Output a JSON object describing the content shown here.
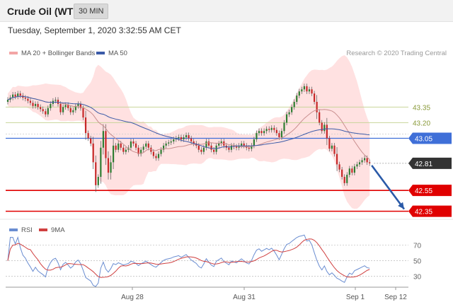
{
  "header": {
    "title": "Crude Oil (WTI)",
    "timeframe": "30 MIN"
  },
  "datetime": "Tuesday, September 1, 2020 3:32:55 AM CET",
  "colors": {
    "bollinger": "#ffc8c8",
    "ma20": "#c98f8f",
    "ma50": "#3b5ba8",
    "support": "#e00000",
    "resistance": "#c8d49a",
    "pivot": "#3f6fd8",
    "price_tag": "#333333",
    "rsi": "#6a8dd1",
    "rsi_ma": "#d04040",
    "arrow": "#2a5aa8"
  },
  "chart_data": [
    {
      "type": "candlestick",
      "legend": [
        "MA 20 + Bollinger Bands",
        "MA 50"
      ],
      "credit": "Research © 2020 Trading Central",
      "levels": [
        {
          "value": 43.35,
          "label": "43.35",
          "kind": "resistance"
        },
        {
          "value": 43.2,
          "label": "43.20",
          "kind": "resistance"
        },
        {
          "value": 43.05,
          "label": "43.05",
          "kind": "pivot"
        },
        {
          "value": 42.81,
          "label": "42.81",
          "kind": "last"
        },
        {
          "value": 42.55,
          "label": "42.55",
          "kind": "support"
        },
        {
          "value": 42.35,
          "label": "42.35",
          "kind": "support"
        }
      ],
      "ylim": [
        42.3,
        43.78
      ],
      "x_ticks": [
        "Aug 28",
        "Aug 31",
        "Sep 1",
        "Sep 12"
      ],
      "close": [
        43.42,
        43.44,
        43.47,
        43.45,
        43.48,
        43.46,
        43.44,
        43.43,
        43.41,
        43.39,
        43.36,
        43.38,
        43.35,
        43.33,
        43.31,
        43.28,
        43.34,
        43.38,
        43.41,
        43.42,
        43.38,
        43.3,
        43.35,
        43.37,
        43.34,
        43.3,
        43.32,
        43.36,
        43.38,
        43.34,
        43.25,
        43.1,
        43.05,
        43.0,
        42.82,
        42.6,
        42.68,
        42.96,
        43.12,
        42.86,
        42.72,
        42.82,
        42.98,
        42.94,
        43.0,
        42.96,
        42.92,
        42.94,
        42.96,
        43.02,
        43.0,
        42.96,
        42.9,
        42.94,
        42.97,
        43.0,
        42.96,
        42.92,
        42.88,
        42.86,
        42.9,
        42.94,
        42.98,
        43.0,
        43.01,
        43.02,
        43.04,
        43.05,
        43.06,
        43.04,
        43.06,
        43.08,
        43.05,
        43.02,
        43.0,
        42.98,
        42.94,
        42.92,
        42.96,
        43.02,
        42.98,
        42.94,
        42.92,
        42.98,
        43.0,
        43.02,
        42.98,
        42.96,
        42.94,
        42.98,
        42.97,
        42.96,
        42.98,
        43.0,
        42.98,
        42.96,
        42.95,
        42.98,
        43.04,
        43.1,
        43.12,
        43.1,
        43.12,
        43.14,
        43.13,
        43.15,
        43.13,
        43.1,
        43.06,
        43.12,
        43.2,
        43.28,
        43.3,
        43.35,
        43.4,
        43.46,
        43.5,
        43.52,
        43.55,
        43.5,
        43.52,
        43.48,
        43.4,
        43.3,
        43.2,
        43.12,
        43.18,
        43.05,
        42.95,
        42.98,
        42.9,
        42.8,
        42.75,
        42.68,
        42.62,
        42.7,
        42.76,
        42.72,
        42.78,
        42.8,
        42.82,
        42.84,
        42.86,
        42.82,
        42.81
      ]
    },
    {
      "type": "line",
      "legend": [
        "RSI",
        "9MA"
      ],
      "y_ticks": [
        70,
        50,
        30
      ],
      "ylim": [
        17,
        85
      ]
    }
  ]
}
